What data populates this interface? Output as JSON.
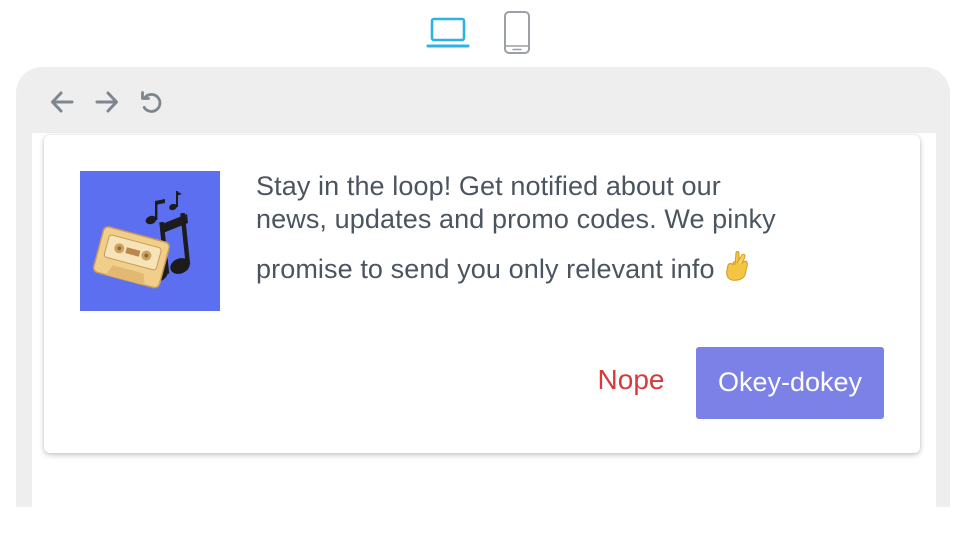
{
  "device_switcher": {
    "options": [
      "desktop-icon",
      "mobile-icon"
    ],
    "selected": "desktop",
    "active_color": "#2bb3e6",
    "inactive_color": "#9aa0a6"
  },
  "browser": {
    "nav_icons": [
      "back-arrow-icon",
      "forward-arrow-icon",
      "reload-icon"
    ]
  },
  "prompt": {
    "image_icon": "music-cassette-icon",
    "image_bg_color": "#5c6ff0",
    "message_lines": [
      "Stay in the loop! Get notified about our",
      "news, updates and promo codes. We pinky",
      "promise to send you only relevant info"
    ],
    "emoji": "crossed-fingers-icon",
    "decline_label": "Nope",
    "decline_color": "#d63b3b",
    "accept_label": "Okey-dokey",
    "accept_bg_color": "#7c81e8"
  }
}
